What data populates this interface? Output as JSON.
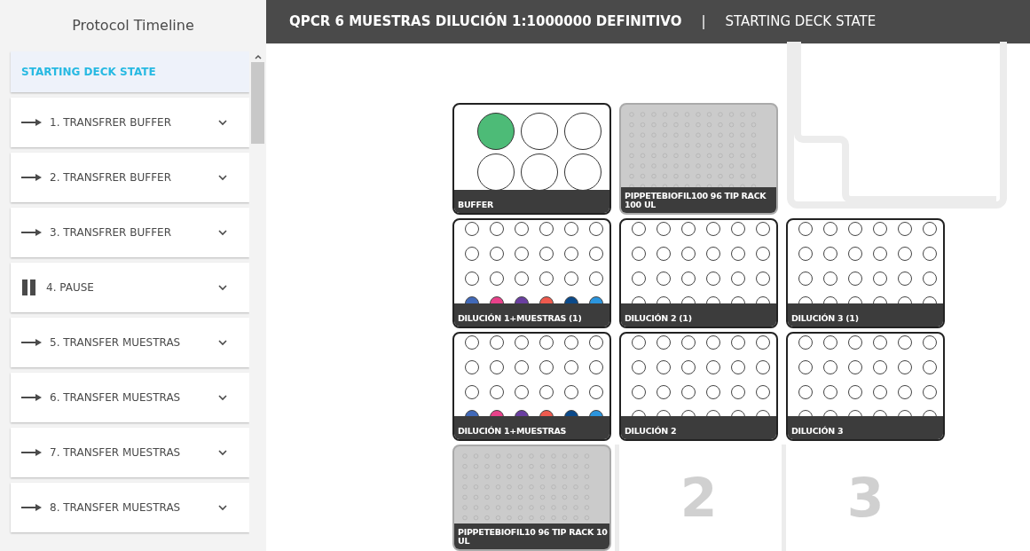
{
  "sidebar": {
    "title": "Protocol Timeline",
    "items": [
      {
        "kind": "start",
        "label": "STARTING DECK STATE",
        "selected": true
      },
      {
        "kind": "transfer",
        "label": "1. TRANSFRER BUFFER",
        "selected": false,
        "expanded": false
      },
      {
        "kind": "transfer",
        "label": "2. TRANSFRER BUFFER",
        "selected": false,
        "expanded": false
      },
      {
        "kind": "transfer",
        "label": "3. TRANSFRER BUFFER",
        "selected": false,
        "expanded": false
      },
      {
        "kind": "pause",
        "label": "4. PAUSE",
        "selected": false,
        "expanded": false
      },
      {
        "kind": "transfer",
        "label": "5. TRANSFER MUESTRAS",
        "selected": false,
        "expanded": false
      },
      {
        "kind": "transfer",
        "label": "6. TRANSFER MUESTRAS",
        "selected": false,
        "expanded": false
      },
      {
        "kind": "transfer",
        "label": "7. TRANSFER MUESTRAS",
        "selected": false,
        "expanded": false
      },
      {
        "kind": "transfer",
        "label": "8. TRANSFER MUESTRAS",
        "selected": false,
        "expanded": false
      }
    ]
  },
  "header": {
    "protocol": "QPCR 6 MUESTRAS DILUCIÓN 1:1000000 DEFINITIVO",
    "separator": "|",
    "view": "STARTING DECK STATE"
  },
  "deck": {
    "slots": [
      {
        "kind": "reservoir",
        "label": "BUFFER",
        "wells": [
          {
            "filled": true,
            "color": "#4dbb77"
          },
          {
            "filled": false
          },
          {
            "filled": false
          },
          {
            "filled": false
          },
          {
            "filled": false
          },
          {
            "filled": false
          }
        ]
      },
      {
        "kind": "tiprack",
        "label": "PIPPETEBIOFIL100 96 TIP RACK 100 UL"
      },
      {
        "kind": "trash"
      },
      {
        "kind": "plate",
        "label": "DILUCIÓN 1+MUESTRAS (1)",
        "wells": [
          {
            "filled": false
          },
          {
            "filled": false
          },
          {
            "filled": false
          },
          {
            "filled": false
          },
          {
            "filled": false
          },
          {
            "filled": false
          },
          {
            "filled": false
          },
          {
            "filled": false
          },
          {
            "filled": false
          },
          {
            "filled": false
          },
          {
            "filled": false
          },
          {
            "filled": false
          },
          {
            "filled": false
          },
          {
            "filled": false
          },
          {
            "filled": false
          },
          {
            "filled": false
          },
          {
            "filled": false
          },
          {
            "filled": false
          },
          {
            "filled": true,
            "color": "#4169b8"
          },
          {
            "filled": true,
            "color": "#e8418a"
          },
          {
            "filled": true,
            "color": "#6a3fa0"
          },
          {
            "filled": true,
            "color": "#ee5a4e"
          },
          {
            "filled": true,
            "color": "#0b4a8a"
          },
          {
            "filled": true,
            "color": "#2b95de"
          }
        ]
      },
      {
        "kind": "plate",
        "label": "DILUCIÓN 2 (1)",
        "wells": [
          {
            "filled": false
          },
          {
            "filled": false
          },
          {
            "filled": false
          },
          {
            "filled": false
          },
          {
            "filled": false
          },
          {
            "filled": false
          },
          {
            "filled": false
          },
          {
            "filled": false
          },
          {
            "filled": false
          },
          {
            "filled": false
          },
          {
            "filled": false
          },
          {
            "filled": false
          },
          {
            "filled": false
          },
          {
            "filled": false
          },
          {
            "filled": false
          },
          {
            "filled": false
          },
          {
            "filled": false
          },
          {
            "filled": false
          },
          {
            "filled": false
          },
          {
            "filled": false
          },
          {
            "filled": false
          },
          {
            "filled": false
          },
          {
            "filled": false
          },
          {
            "filled": false
          }
        ]
      },
      {
        "kind": "plate",
        "label": "DILUCIÓN 3 (1)",
        "wells": [
          {
            "filled": false
          },
          {
            "filled": false
          },
          {
            "filled": false
          },
          {
            "filled": false
          },
          {
            "filled": false
          },
          {
            "filled": false
          },
          {
            "filled": false
          },
          {
            "filled": false
          },
          {
            "filled": false
          },
          {
            "filled": false
          },
          {
            "filled": false
          },
          {
            "filled": false
          },
          {
            "filled": false
          },
          {
            "filled": false
          },
          {
            "filled": false
          },
          {
            "filled": false
          },
          {
            "filled": false
          },
          {
            "filled": false
          },
          {
            "filled": false
          },
          {
            "filled": false
          },
          {
            "filled": false
          },
          {
            "filled": false
          },
          {
            "filled": false
          },
          {
            "filled": false
          }
        ]
      },
      {
        "kind": "plate",
        "label": "DILUCIÓN 1+MUESTRAS",
        "wells": [
          {
            "filled": false
          },
          {
            "filled": false
          },
          {
            "filled": false
          },
          {
            "filled": false
          },
          {
            "filled": false
          },
          {
            "filled": false
          },
          {
            "filled": false
          },
          {
            "filled": false
          },
          {
            "filled": false
          },
          {
            "filled": false
          },
          {
            "filled": false
          },
          {
            "filled": false
          },
          {
            "filled": false
          },
          {
            "filled": false
          },
          {
            "filled": false
          },
          {
            "filled": false
          },
          {
            "filled": false
          },
          {
            "filled": false
          },
          {
            "filled": true,
            "color": "#4169b8"
          },
          {
            "filled": true,
            "color": "#e8418a"
          },
          {
            "filled": true,
            "color": "#6a3fa0"
          },
          {
            "filled": true,
            "color": "#ee5a4e"
          },
          {
            "filled": true,
            "color": "#0b4a8a"
          },
          {
            "filled": true,
            "color": "#2b95de"
          }
        ]
      },
      {
        "kind": "plate",
        "label": "DILUCIÓN 2",
        "wells": [
          {
            "filled": false
          },
          {
            "filled": false
          },
          {
            "filled": false
          },
          {
            "filled": false
          },
          {
            "filled": false
          },
          {
            "filled": false
          },
          {
            "filled": false
          },
          {
            "filled": false
          },
          {
            "filled": false
          },
          {
            "filled": false
          },
          {
            "filled": false
          },
          {
            "filled": false
          },
          {
            "filled": false
          },
          {
            "filled": false
          },
          {
            "filled": false
          },
          {
            "filled": false
          },
          {
            "filled": false
          },
          {
            "filled": false
          },
          {
            "filled": false
          },
          {
            "filled": false
          },
          {
            "filled": false
          },
          {
            "filled": false
          },
          {
            "filled": false
          },
          {
            "filled": false
          }
        ]
      },
      {
        "kind": "plate",
        "label": "DILUCIÓN 3",
        "wells": [
          {
            "filled": false
          },
          {
            "filled": false
          },
          {
            "filled": false
          },
          {
            "filled": false
          },
          {
            "filled": false
          },
          {
            "filled": false
          },
          {
            "filled": false
          },
          {
            "filled": false
          },
          {
            "filled": false
          },
          {
            "filled": false
          },
          {
            "filled": false
          },
          {
            "filled": false
          },
          {
            "filled": false
          },
          {
            "filled": false
          },
          {
            "filled": false
          },
          {
            "filled": false
          },
          {
            "filled": false
          },
          {
            "filled": false
          },
          {
            "filled": false
          },
          {
            "filled": false
          },
          {
            "filled": false
          },
          {
            "filled": false
          },
          {
            "filled": false
          },
          {
            "filled": false
          }
        ]
      },
      {
        "kind": "tiprack",
        "label": "PIPPETEBIOFIL10 96 TIP RACK 10 UL"
      },
      {
        "kind": "empty",
        "number": "2"
      },
      {
        "kind": "empty",
        "number": "3"
      }
    ]
  }
}
